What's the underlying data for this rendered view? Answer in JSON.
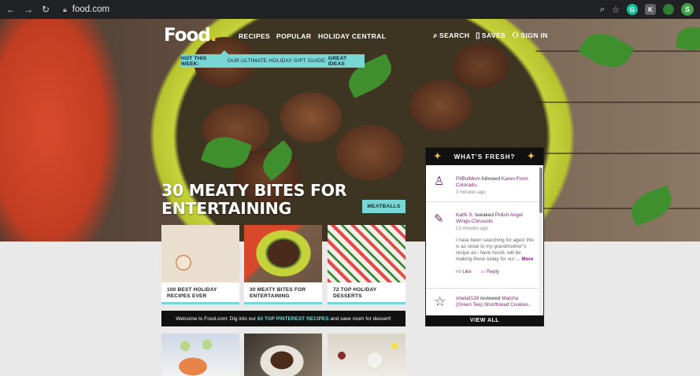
{
  "browser": {
    "url": "food.com",
    "profile_initial": "S",
    "extensions": [
      "G",
      "K"
    ]
  },
  "site": {
    "logo": "Food",
    "logo_dot": ".",
    "nav": [
      "RECIPES",
      "POPULAR",
      "HOLIDAY CENTRAL"
    ],
    "search": "SEARCH",
    "saves": "SAVES",
    "signin": "SIGN IN"
  },
  "promo": {
    "prefix": "HOT THIS WEEK:",
    "text": " OUR ULTIMATE HOLIDAY GIFT GUIDE: ",
    "cta": "GREAT IDEAS"
  },
  "hero": {
    "headline_line1": "30 MEATY BITES FOR",
    "headline_line2": "ENTERTAINING",
    "tag": "MEATBALLS"
  },
  "cards": [
    {
      "line1": "100 BEST HOLIDAY",
      "line2": "RECIPES EVER"
    },
    {
      "line1": "30 MEATY BITES FOR",
      "line2": "ENTERTAINING"
    },
    {
      "line1": "72 TOP HOLIDAY",
      "line2": "DESSERTS"
    }
  ],
  "welcome": {
    "before": "Welcome to Food.com: Dig into our ",
    "link": "63 TOP PINTEREST RECIPES",
    "after": " and save room for dessert!"
  },
  "fresh": {
    "title": "WHAT'S FRESH?",
    "view_all": "VIEW ALL",
    "items": [
      {
        "user": "PitBulMom",
        "action": " followed ",
        "target": "Karen From Colorado",
        "end": ".",
        "time": "3 minutes ago"
      },
      {
        "user": "Kathi S.",
        "action": " tweaked ",
        "target": "Polish Angel Wings-Chrusciki",
        "end": ".",
        "time": "13 minutes ago",
        "body": "i have been searching for ages! this is as close to my grandmother\"s recipe as i have found. will be making these today for our ... ",
        "more": "More",
        "like": "Like",
        "reply": "Reply"
      },
      {
        "user": "sheilaf138",
        "action": " reviewed ",
        "target": "Matcha (Green Tea) Shortbread Cookies",
        "end": "."
      }
    ]
  }
}
